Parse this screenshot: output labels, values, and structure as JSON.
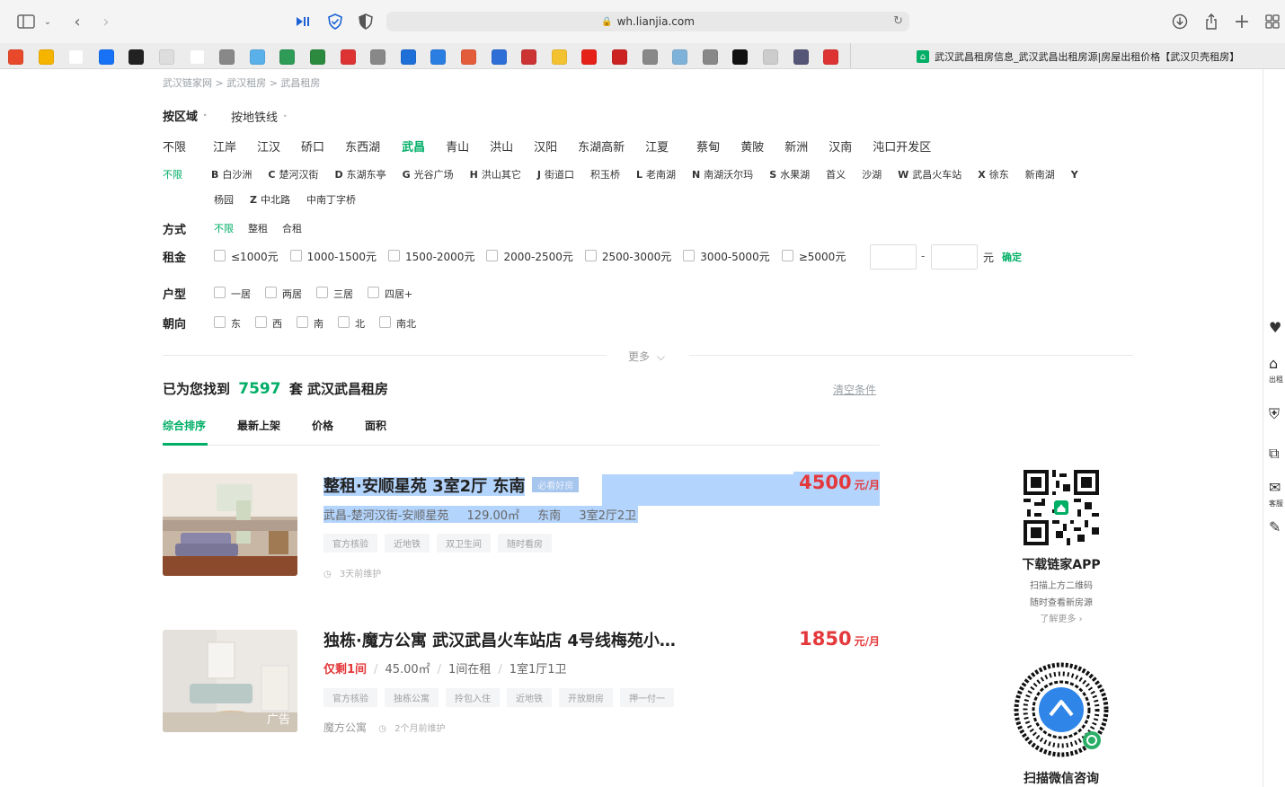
{
  "browser": {
    "url": "wh.lianjia.com",
    "tab_title": "武汉武昌租房信息_武汉武昌出租房源|房屋出租价格【武汉贝壳租房】",
    "favorites": [
      {
        "icon": "c-icon",
        "color": "#e8492a"
      },
      {
        "icon": "pencil-icon",
        "color": "#f4b400"
      },
      {
        "icon": "app-icon",
        "color": "#fff"
      },
      {
        "icon": "zhihu-icon",
        "color": "#1772f6"
      },
      {
        "icon": "github-icon",
        "color": "#222"
      },
      {
        "icon": "nike-icon",
        "color": "#ddd"
      },
      {
        "icon": "adidas-icon",
        "color": "#fff"
      },
      {
        "icon": "l-icon",
        "color": "#888"
      },
      {
        "icon": "bilibili-icon",
        "color": "#5ab0e8"
      },
      {
        "icon": "flag-icon",
        "color": "#2e9b57"
      },
      {
        "icon": "six-icon",
        "color": "#2b8a3e"
      },
      {
        "icon": "music-icon",
        "color": "#d33"
      },
      {
        "icon": "l-icon",
        "color": "#888"
      },
      {
        "icon": "on-icon",
        "color": "#1f6fd8"
      },
      {
        "icon": "grid-icon",
        "color": "#2a7de1"
      },
      {
        "icon": "cloud-icon",
        "color": "#e45d3a"
      },
      {
        "icon": "k-icon",
        "color": "#2d6fd6"
      },
      {
        "icon": "target-icon",
        "color": "#c33"
      },
      {
        "icon": "mail-icon",
        "color": "#f2c230"
      },
      {
        "icon": "youtube-icon",
        "color": "#e62117"
      },
      {
        "icon": "square-icon",
        "color": "#c22"
      },
      {
        "icon": "y-icon",
        "color": "#888"
      },
      {
        "icon": "map-icon",
        "color": "#7fb2d8"
      },
      {
        "icon": "j-icon",
        "color": "#888"
      },
      {
        "icon": "moon-icon",
        "color": "#111"
      },
      {
        "icon": "doc-icon",
        "color": "#ccc"
      },
      {
        "icon": "photo-icon",
        "color": "#557"
      },
      {
        "icon": "cap-icon",
        "color": "#d33"
      }
    ]
  },
  "breadcrumb": "武汉链家网 >  武汉租房 >  武昌租房",
  "filter_tabs": {
    "area": "按区域",
    "subway": "按地铁线"
  },
  "districts": [
    "不限",
    "江岸",
    "江汉",
    "硚口",
    "东西湖",
    "武昌",
    "青山",
    "洪山",
    "汉阳",
    "东湖高新",
    "江夏",
    "蔡甸",
    "黄陂",
    "新洲",
    "汉南",
    "沌口开发区"
  ],
  "active_district": "武昌",
  "subareas_row1": [
    {
      "letter": "",
      "name": "不限"
    },
    {
      "letter": "B",
      "name": "白沙洲"
    },
    {
      "letter": "C",
      "name": "楚河汉街"
    },
    {
      "letter": "D",
      "name": "东湖东亭"
    },
    {
      "letter": "G",
      "name": "光谷广场"
    },
    {
      "letter": "H",
      "name": "洪山其它"
    },
    {
      "letter": "J",
      "name": "街道口"
    },
    {
      "letter": "",
      "name": "积玉桥"
    },
    {
      "letter": "L",
      "name": "老南湖"
    },
    {
      "letter": "N",
      "name": "南湖沃尔玛"
    },
    {
      "letter": "S",
      "name": "水果湖"
    },
    {
      "letter": "",
      "name": "首义"
    },
    {
      "letter": "",
      "name": "沙湖"
    },
    {
      "letter": "W",
      "name": "武昌火车站"
    },
    {
      "letter": "X",
      "name": "徐东"
    },
    {
      "letter": "",
      "name": "新南湖"
    },
    {
      "letter": "Y",
      "name": ""
    }
  ],
  "subareas_row2": [
    {
      "letter": "",
      "name": "杨园"
    },
    {
      "letter": "Z",
      "name": "中北路"
    },
    {
      "letter": "",
      "name": "中南丁字桥"
    }
  ],
  "mode": {
    "label": "方式",
    "options": [
      "不限",
      "整租",
      "合租"
    ]
  },
  "rent": {
    "label": "租金",
    "options": [
      "≤1000元",
      "1000-1500元",
      "1500-2000元",
      "2000-2500元",
      "2500-3000元",
      "3000-5000元",
      "≥5000元"
    ],
    "dash": "-",
    "unit": "元",
    "confirm": "确定"
  },
  "layout": {
    "label": "户型",
    "options": [
      "一居",
      "两居",
      "三居",
      "四居+"
    ]
  },
  "orientation": {
    "label": "朝向",
    "options": [
      "东",
      "西",
      "南",
      "北",
      "南北"
    ]
  },
  "more": "更多",
  "result": {
    "prefix": "已为您找到",
    "count": "7597",
    "suffix": "套 武汉武昌租房",
    "clear": "清空条件"
  },
  "sort_tabs": [
    "综合排序",
    "最新上架",
    "价格",
    "面积"
  ],
  "listings": [
    {
      "title": "整租·安顺星苑 3室2厅 东南",
      "badge": "必看好房",
      "price": "4500",
      "price_unit": "元/月",
      "info": [
        "武昌-楚河汉街-安顺星苑",
        "129.00㎡",
        "东南",
        "3室2厅2卫"
      ],
      "tags": [
        "官方核验",
        "近地铁",
        "双卫生间",
        "随时看房"
      ],
      "meta": "3天前维护"
    },
    {
      "title": "独栋·魔方公寓 武汉武昌火车站店 4号线梅苑小…",
      "price": "1850",
      "price_unit": "元/月",
      "info_highlight": "仅剩1间",
      "info": [
        "45.00㎡",
        "1间在租",
        "1室1厅1卫"
      ],
      "tags": [
        "官方核验",
        "独栋公寓",
        "拎包入住",
        "近地铁",
        "开放厨房",
        "押一付一"
      ],
      "brand": "魔方公寓",
      "meta": "2个月前维护",
      "ad": "广告"
    }
  ],
  "side": {
    "app_title": "下载链家APP",
    "app_sub1": "扫描上方二维码",
    "app_sub2": "随时查看新房源",
    "app_more": "了解更多 ›",
    "wechat_title": "扫描微信咨询"
  },
  "right_rail": [
    {
      "icon": "heart-icon",
      "label": ""
    },
    {
      "icon": "house-icon",
      "label": "出租"
    },
    {
      "icon": "shield-icon",
      "label": ""
    },
    {
      "icon": "compare-icon",
      "label": ""
    },
    {
      "icon": "chat-icon",
      "label": "客服"
    },
    {
      "icon": "edit-icon",
      "label": ""
    }
  ]
}
